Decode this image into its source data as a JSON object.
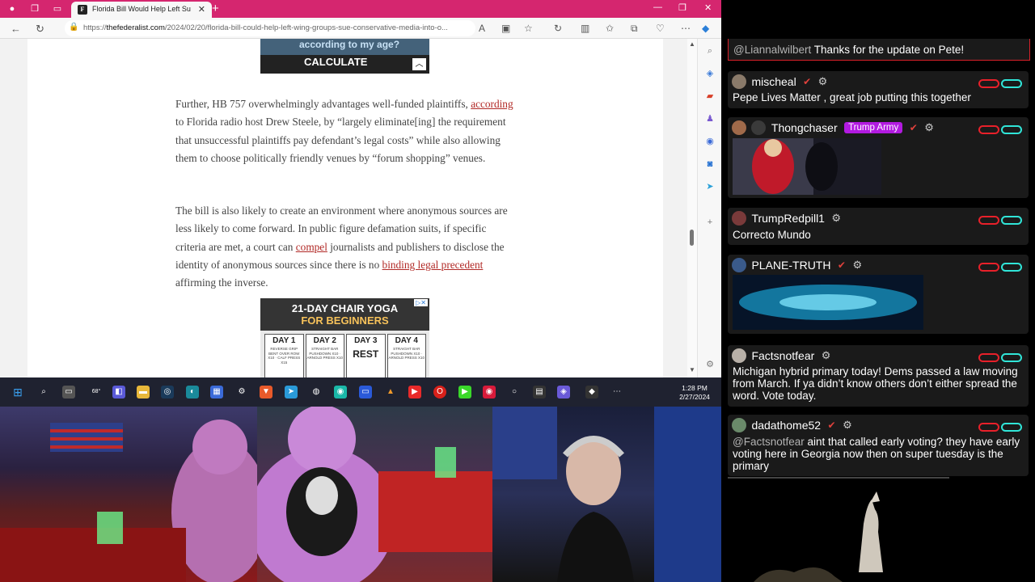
{
  "browser": {
    "tab_title": "Florida Bill Would Help Left Su",
    "url_prefix": "https://",
    "url_domain": "thefederalist.com",
    "url_path": "/2024/02/20/florida-bill-could-help-left-wing-groups-sue-conservative-media-into-o...",
    "accent_color": "#d5266f"
  },
  "article": {
    "ad_top_partial": "according to my age?",
    "ad_top_button": "CALCULATE",
    "p1_a": "Further, HB 757 overwhelmingly advantages well-funded plaintiffs, ",
    "p1_link": "according",
    "p1_b": " to Florida radio host Drew Steele, by “largely eliminate[ing] the requirement that unsuccessful plaintiffs pay defendant’s legal costs” while also allowing them to choose politically friendly venues by “forum shopping” venues.",
    "p2_a": "The bill is also likely to create an environment where anonymous sources are less likely to come forward. In public figure defamation suits, if specific criteria are met, a court can ",
    "p2_link1": "compel",
    "p2_b": " journalists and publishers to disclose the identity of anonymous sources since there is no ",
    "p2_link2": "binding legal precedent",
    "p2_c": " affirming the inverse.",
    "ad_yoga": {
      "title1": "21-DAY CHAIR YOGA",
      "title2": "FOR BEGINNERS",
      "days": [
        {
          "label": "DAY 1",
          "detail": "REVERSE GRIP BENT OVER ROW X10 · CALF PRESS X15"
        },
        {
          "label": "DAY 2",
          "detail": "STRAIGHT BAR PUSHDOWN X10 · ARNOLD PRESS X10"
        },
        {
          "label": "DAY 3",
          "detail": "REST"
        },
        {
          "label": "DAY 4",
          "detail": "STRAIGHT BAR PUSHDOWN X10 · ARNOLD PRESS X10"
        }
      ]
    }
  },
  "taskbar": {
    "weather": "68°",
    "time": "1:28 PM",
    "date": "2/27/2024"
  },
  "chat": {
    "top_message": {
      "mention": "@Liannalwilbert",
      "text": " Thanks for the update on Pete!"
    },
    "messages": [
      {
        "user": "mischeal",
        "text": "Pepe Lives Matter , great job putting this together",
        "avatar_color": "#8a7a6a"
      },
      {
        "user": "Thongchaser",
        "badge": "Trump Army",
        "text": "",
        "avatar_color": "#a06a4a"
      },
      {
        "user": "TrumpRedpill1",
        "text": "Correcto Mundo",
        "avatar_color": "#7a3a3a"
      },
      {
        "user": "PLANE-TRUTH",
        "text": "",
        "avatar_color": "#3a5a8a"
      },
      {
        "user": "Factsnotfear",
        "text": "Michigan hybrid primary today! Dems passed a law moving from March. If ya didn’t know others don’t either spread the word. Vote today.",
        "avatar_color": "#b8b0a8"
      },
      {
        "user": "dadathome52",
        "mention": "@Factsnotfear",
        "text": " aint that called early voting? they have early voting here in Georgia now then on super tuesday is the primary",
        "avatar_color": "#6a8a6a"
      }
    ]
  }
}
